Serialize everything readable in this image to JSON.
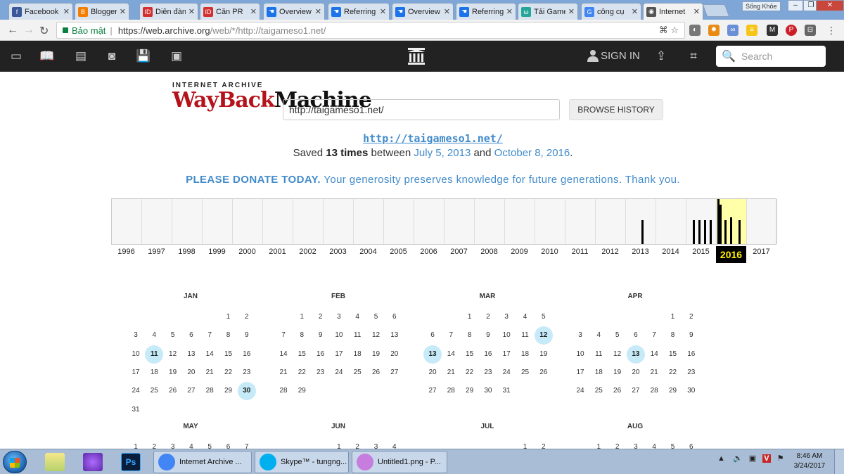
{
  "browser": {
    "tabs": [
      {
        "label": "Facebook",
        "fav_color": "#3b5998",
        "fav_glyph": "f"
      },
      {
        "label": "Blogger",
        "fav_color": "#f57d00",
        "fav_glyph": "B"
      },
      {
        "label": "Diễn đàn",
        "fav_color": "#d32f2f",
        "fav_glyph": "ID"
      },
      {
        "label": "Căn PR",
        "fav_color": "#d32f2f",
        "fav_glyph": "ID"
      },
      {
        "label": "Overview",
        "fav_color": "#1a73e8",
        "fav_glyph": "☚"
      },
      {
        "label": "Referring",
        "fav_color": "#1a73e8",
        "fav_glyph": "☚"
      },
      {
        "label": "Overview",
        "fav_color": "#1a73e8",
        "fav_glyph": "☚"
      },
      {
        "label": "Referring",
        "fav_color": "#1a73e8",
        "fav_glyph": "☚"
      },
      {
        "label": "Tải Game",
        "fav_color": "#26a69a",
        "fav_glyph": "ω"
      },
      {
        "label": "công cụ",
        "fav_color": "#4285f4",
        "fav_glyph": "G"
      },
      {
        "label": "Internet",
        "fav_color": "#555555",
        "fav_glyph": "◉"
      }
    ],
    "profile_name": "Sống Khỏe",
    "secure_label": "Bảo mật",
    "address_prefix": "https://web.archive.org",
    "address_path": "/web/*/http://taigameso1.net/"
  },
  "ia_nav": {
    "signin_label": "SIGN IN",
    "search_placeholder": "Search"
  },
  "wayback": {
    "logo_top": "INTERNET ARCHIVE",
    "logo_word1": "WayBack",
    "logo_word2": "Machine",
    "url_value": "http://taigameso1.net/",
    "browse_label": "BROWSE HISTORY",
    "site_url": "http://taigameso1.net/",
    "saved_prefix": "Saved",
    "saved_count": "13 times",
    "saved_between": "between",
    "first_date": "July 5, 2013",
    "saved_and": "and",
    "last_date": "October 8, 2016",
    "saved_end": ".",
    "donate_bold": "PLEASE DONATE TODAY.",
    "donate_text": "Your generosity preserves knowledge for future generations. Thank you."
  },
  "histogram": {
    "years": [
      "1996",
      "1997",
      "1998",
      "1999",
      "2000",
      "2001",
      "2002",
      "2003",
      "2004",
      "2005",
      "2006",
      "2007",
      "2008",
      "2009",
      "2010",
      "2011",
      "2012",
      "2013",
      "2014",
      "2015",
      "2016",
      "2017"
    ],
    "selected_year": "2016",
    "bars": [
      {
        "year": "2013",
        "offset": 0.5,
        "level": 0.53
      },
      {
        "year": "2015",
        "offset": 0.22,
        "level": 0.53
      },
      {
        "year": "2015",
        "offset": 0.4,
        "level": 0.53
      },
      {
        "year": "2015",
        "offset": 0.58,
        "level": 0.53
      },
      {
        "year": "2015",
        "offset": 0.76,
        "level": 0.53
      },
      {
        "year": "2016",
        "offset": 0.02,
        "level": 1.0
      },
      {
        "year": "2016",
        "offset": 0.1,
        "level": 0.88
      },
      {
        "year": "2016",
        "offset": 0.26,
        "level": 0.53
      },
      {
        "year": "2016",
        "offset": 0.44,
        "level": 0.6
      },
      {
        "year": "2016",
        "offset": 0.72,
        "level": 0.53
      }
    ]
  },
  "calendar": [
    {
      "name": "JAN",
      "start": 5,
      "days": 31,
      "snaps": [
        11,
        30
      ],
      "full": true
    },
    {
      "name": "FEB",
      "start": 1,
      "days": 29,
      "snaps": [],
      "full": true
    },
    {
      "name": "MAR",
      "start": 2,
      "days": 31,
      "snaps": [
        12,
        13
      ],
      "full": true
    },
    {
      "name": "APR",
      "start": 5,
      "days": 30,
      "snaps": [
        13
      ],
      "full": true
    },
    {
      "name": "MAY",
      "start": 0,
      "days": 7,
      "snaps": [],
      "full": false
    },
    {
      "name": "JUN",
      "start": 3,
      "days": 4,
      "snaps": [],
      "full": false
    },
    {
      "name": "JUL",
      "start": 5,
      "days": 2,
      "snaps": [],
      "full": false
    },
    {
      "name": "AUG",
      "start": 1,
      "days": 6,
      "snaps": [],
      "full": false
    }
  ],
  "taskbar": {
    "items": [
      {
        "label": "Internet Archive ...",
        "color": "#4285f4"
      },
      {
        "label": "Skype™ - tungng...",
        "color": "#00aff0"
      },
      {
        "label": "Untitled1.png - P...",
        "color": "#c77dde"
      }
    ],
    "time": "8:46 AM",
    "date": "3/24/2017"
  }
}
